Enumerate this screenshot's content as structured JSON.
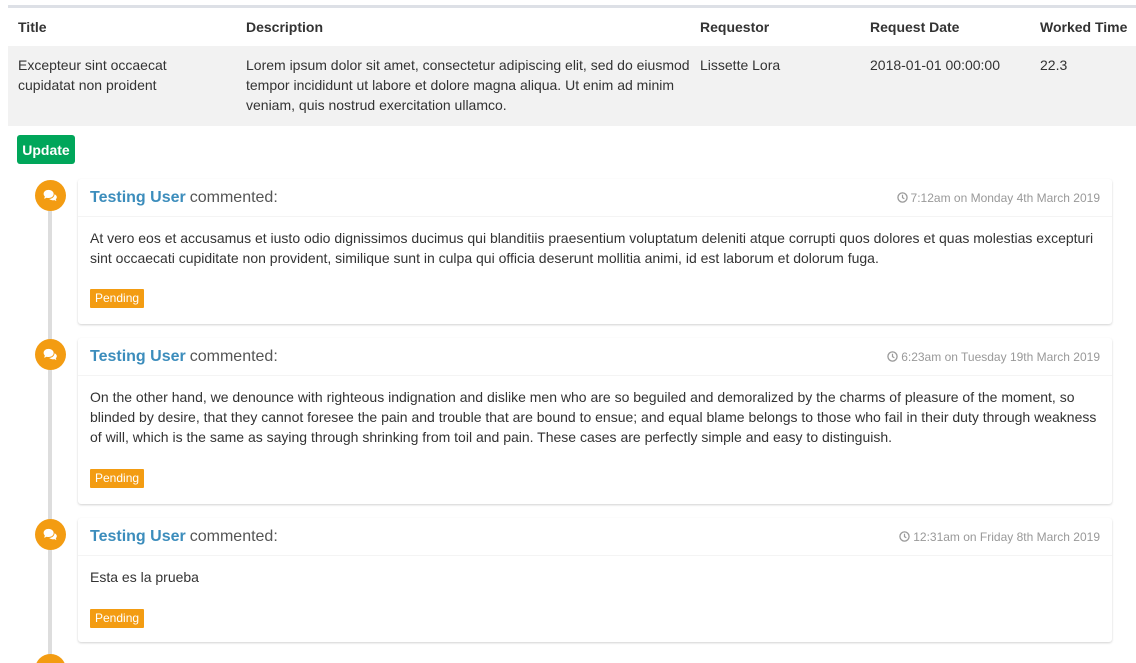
{
  "table": {
    "headers": {
      "title": "Title",
      "description": "Description",
      "requestor": "Requestor",
      "request_date": "Request Date",
      "worked_time": "Worked Time"
    },
    "row": {
      "title": "Excepteur sint occaecat cupidatat non proident",
      "description": "Lorem ipsum dolor sit amet, consectetur adipiscing elit, sed do eiusmod tempor incididunt ut labore et dolore magna aliqua. Ut enim ad minim veniam, quis nostrud exercitation ullamco.",
      "requestor": "Lissette Lora",
      "request_date": "2018-01-01 00:00:00",
      "worked_time": "22.3"
    }
  },
  "actions": {
    "update_label": "Update"
  },
  "colors": {
    "update_button": "#00a65a",
    "timeline_icon": "#f39c12",
    "pending_badge": "#f39c12",
    "author_link": "#3c8dbc",
    "table_row": "#f2f2f2"
  },
  "comments": [
    {
      "icon": "comments-icon",
      "author": "Testing User",
      "verb": "commented:",
      "time": "7:12am on Monday 4th March 2019",
      "body": "At vero eos et accusamus et iusto odio dignissimos ducimus qui blanditiis praesentium voluptatum deleniti atque corrupti quos dolores et quas molestias excepturi sint occaecati cupiditate non provident, similique sunt in culpa qui officia deserunt mollitia animi, id est laborum et dolorum fuga.",
      "status": "Pending"
    },
    {
      "icon": "comments-icon",
      "author": "Testing User",
      "verb": "commented:",
      "time": "6:23am on Tuesday 19th March 2019",
      "body": "On the other hand, we denounce with righteous indignation and dislike men who are so beguiled and demoralized by the charms of pleasure of the moment, so blinded by desire, that they cannot foresee the pain and trouble that are bound to ensue; and equal blame belongs to those who fail in their duty through weakness of will, which is the same as saying through shrinking from toil and pain. These cases are perfectly simple and easy to distinguish.",
      "status": "Pending"
    },
    {
      "icon": "comments-icon",
      "author": "Testing User",
      "verb": "commented:",
      "time": "12:31am on Friday 8th March 2019",
      "body": "Esta es la prueba",
      "status": "Pending"
    }
  ]
}
